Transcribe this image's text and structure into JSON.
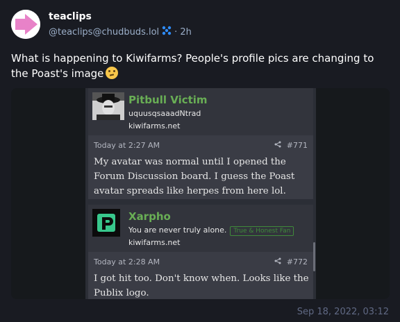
{
  "account": {
    "display_name": "teaclips",
    "handle": "@teaclips@chudbuds.lol",
    "relative_time": "2h"
  },
  "status": {
    "text": "What is happening to Kiwifarms? People's profile pics are changing to the Poast's image",
    "emoji": "thinking-face-emoji",
    "timestamp": "Sep 18, 2022, 03:12"
  },
  "media": {
    "posts": [
      {
        "user": "Pitbull Victim",
        "title": "uquusqsaaadNtrad",
        "site": "kiwifarms.net",
        "time": "Today at 2:27 AM",
        "number": "#771",
        "body": "My avatar was normal until I opened the Forum Discussion board. I guess the Poast avatar spreads like herpes from here lol."
      },
      {
        "user": "Xarpho",
        "title": "You are never truly alone.",
        "badge": "True & Honest Fan",
        "site": "kiwifarms.net",
        "time": "Today at 2:28 AM",
        "number": "#772",
        "body": "I got hit too. Don't know when. Looks like the Publix logo."
      }
    ]
  },
  "colors": {
    "background": "#191b22",
    "accent_pink": "#e882c8",
    "username_green": "#69ae55"
  }
}
